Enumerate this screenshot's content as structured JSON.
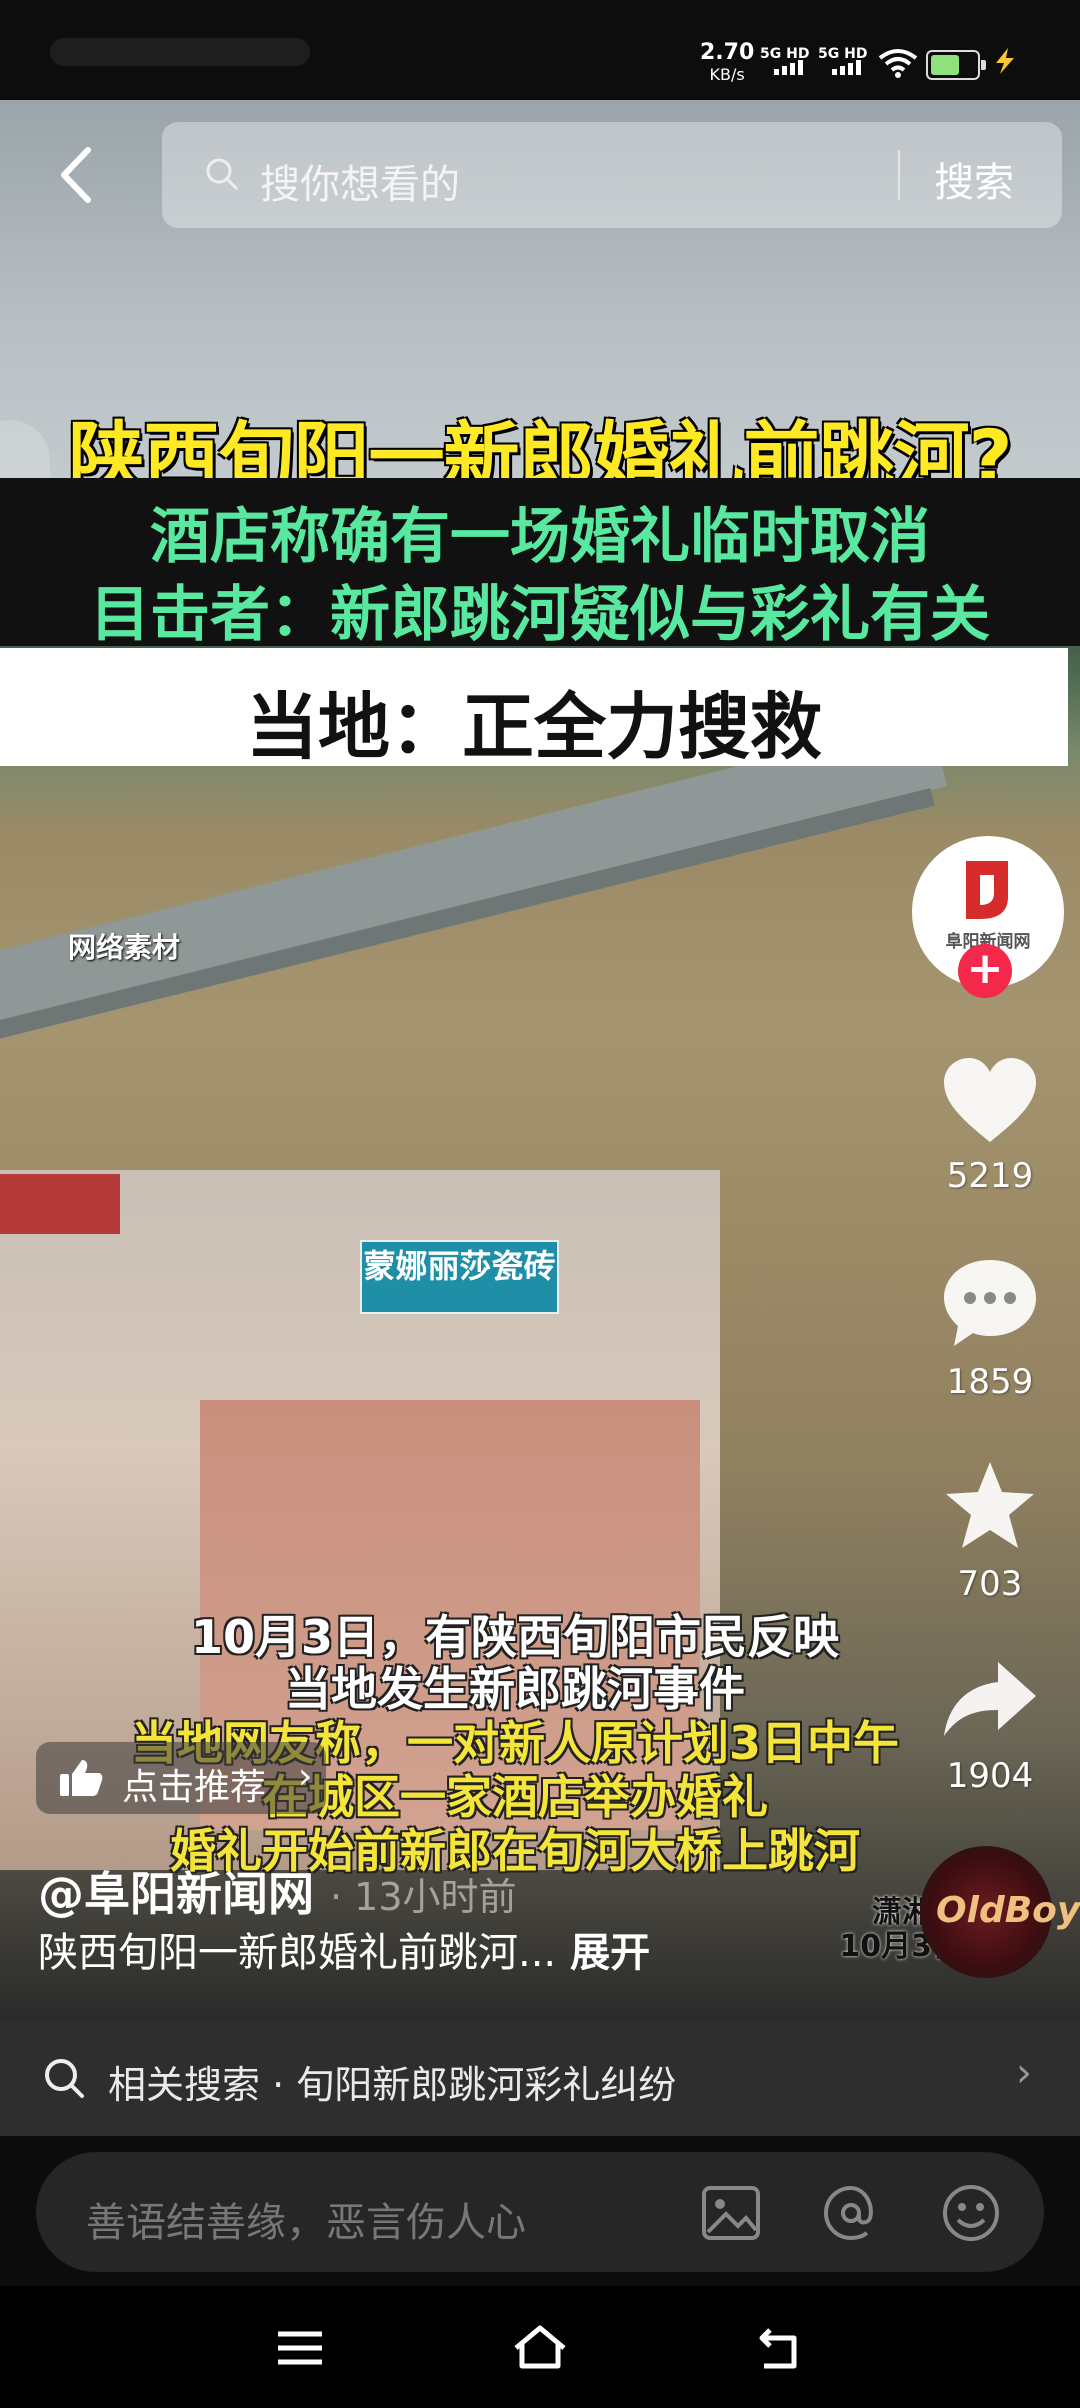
{
  "status": {
    "speed_value": "2.70",
    "speed_unit": "KB/s",
    "sim1": "5G HD",
    "sim2": "5G HD",
    "battery_color": "#8ee27b",
    "charge_color": "#f7c82c"
  },
  "search": {
    "placeholder": "搜你想看的",
    "button": "搜索"
  },
  "video": {
    "headline": "陕西旬阳一新郎婚礼前跳河?",
    "subline_1": "酒店称确有一场婚礼临时取消",
    "subline_2": "目击者：新郎跳河疑似与彩礼有关",
    "white_band": "当地：正全力搜救",
    "source_note": "网络素材",
    "billboard": "蒙娜丽莎瓷砖",
    "captions": [
      "10月3日，有陕西旬阳市民反映",
      "当地发生新郎跳河事件",
      "当地网友称，一对新人原计划3日中午",
      "在城区一家酒店举办婚礼",
      "婚礼开始前新郎在旬河大桥上跳河"
    ],
    "corner_tag_1": "潇湘晨",
    "corner_tag_2": "10月3日"
  },
  "author": {
    "avatar_name": "阜阳新闻网",
    "handle": "@阜阳新闻网",
    "time": "· 13小时前",
    "description": "陕西旬阳一新郎婚礼前跳河...",
    "expand": "展开"
  },
  "actions": {
    "likes": "5219",
    "comments": "1859",
    "favorites": "703",
    "shares": "1904"
  },
  "recommend": {
    "label": "点击推荐"
  },
  "music": {
    "disc_text": "OldBoy"
  },
  "related": {
    "prefix": "相关搜索",
    "query": "旬阳新郎跳河彩礼纠纷"
  },
  "compose": {
    "placeholder": "善语结善缘，恶言伤人心"
  },
  "accent": {
    "follow_red": "#f3284a",
    "headline_yellow": "#ffe824",
    "subline_green": "#58e8a0"
  }
}
